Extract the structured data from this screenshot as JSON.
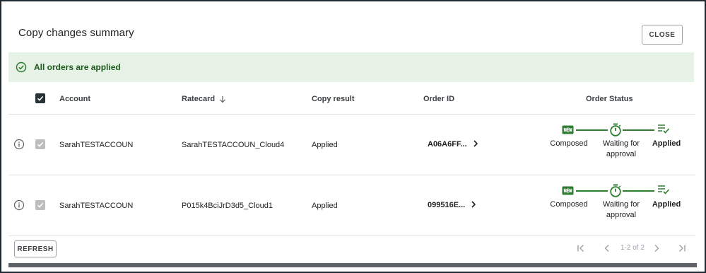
{
  "dialog": {
    "title": "Copy changes summary",
    "close_label": "CLOSE"
  },
  "banner": {
    "message": "All orders are applied",
    "icon": "check-circle-icon",
    "color": "#1e5a1e",
    "background": "#e6f2e6"
  },
  "table": {
    "headers": {
      "account": "Account",
      "ratecard": "Ratecard",
      "copy_result": "Copy result",
      "order_id": "Order ID",
      "order_status": "Order Status"
    },
    "rows": [
      {
        "account": "SarahTESTACCOUN",
        "ratecard": "SarahTESTACCOUN_Cloud4",
        "copy_result": "Applied",
        "order_id": "A06A6FF...",
        "status_steps": [
          "Composed",
          "Waiting for approval",
          "Applied"
        ]
      },
      {
        "account": "SarahTESTACCOUN",
        "ratecard": "P015k4BciJrD3d5_Cloud1",
        "copy_result": "Applied",
        "order_id": "099516E...",
        "status_steps": [
          "Composed",
          "Waiting for approval",
          "Applied"
        ]
      }
    ]
  },
  "footer": {
    "refresh_label": "REFRESH",
    "pagination": "1-2 of 2"
  },
  "colors": {
    "accent_green": "#2e7d32",
    "checkbox_dark": "#263238"
  }
}
